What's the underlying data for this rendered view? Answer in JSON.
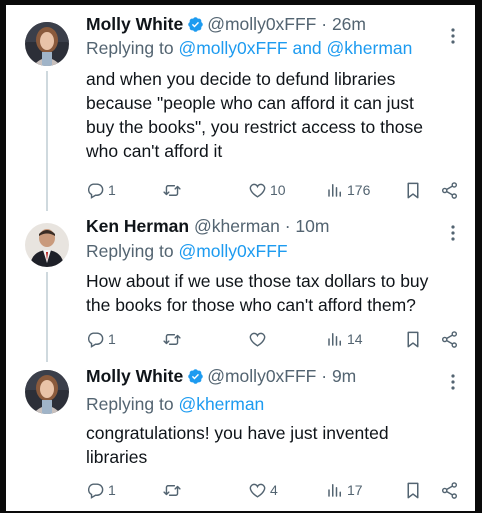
{
  "tweets": [
    {
      "name": "Molly White",
      "handle": "@molly0xFFF",
      "separator": "·",
      "time": "26m",
      "replying_prefix": "Replying to",
      "replying_to": [
        "@molly0xFFF",
        "@kherman"
      ],
      "replying_joiner": "and",
      "lines": [
        "and when you decide to defund libraries",
        "because \"people who can afford it can just",
        "buy the books\", you restrict access to those",
        "who can't afford it"
      ],
      "stats": {
        "replies": "1",
        "retweets": "",
        "likes": "10",
        "views": "176"
      }
    },
    {
      "name": "Ken Herman",
      "handle": "@kherman",
      "separator": "·",
      "time": "10m",
      "replying_prefix": "Replying to",
      "replying_to": [
        "@molly0xFFF"
      ],
      "lines": [
        "How about if we use those tax dollars to buy",
        "the books for those who can't afford them?"
      ],
      "stats": {
        "replies": "1",
        "retweets": "",
        "likes": "",
        "views": "14"
      }
    },
    {
      "name": "Molly White",
      "handle": "@molly0xFFF",
      "separator": "·",
      "time": "9m",
      "replying_prefix": "Replying to",
      "replying_to": [
        "@kherman"
      ],
      "lines": [
        "congratulations! you have just invented",
        "libraries"
      ],
      "stats": {
        "replies": "1",
        "retweets": "",
        "likes": "4",
        "views": "17"
      }
    }
  ],
  "colors": {
    "text": "#0f1419",
    "muted": "#536471",
    "link": "#1d9bf0",
    "verified": "#1d9bf0"
  }
}
